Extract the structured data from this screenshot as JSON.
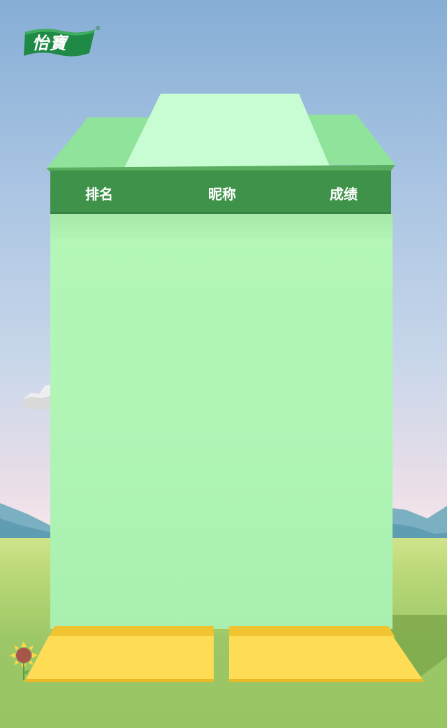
{
  "brand": {
    "logo_text": "怡寶",
    "registered_mark": "®"
  },
  "leaderboard": {
    "columns": {
      "rank": "排名",
      "nickname": "昵称",
      "score": "成绩"
    },
    "rows": []
  },
  "buttons": {
    "left": "",
    "right": ""
  },
  "colors": {
    "header_bg": "#3f924a",
    "board_bg": "#b2f5b7",
    "button_bg": "#ffdc55",
    "logo_bg": "#1f8a45"
  }
}
